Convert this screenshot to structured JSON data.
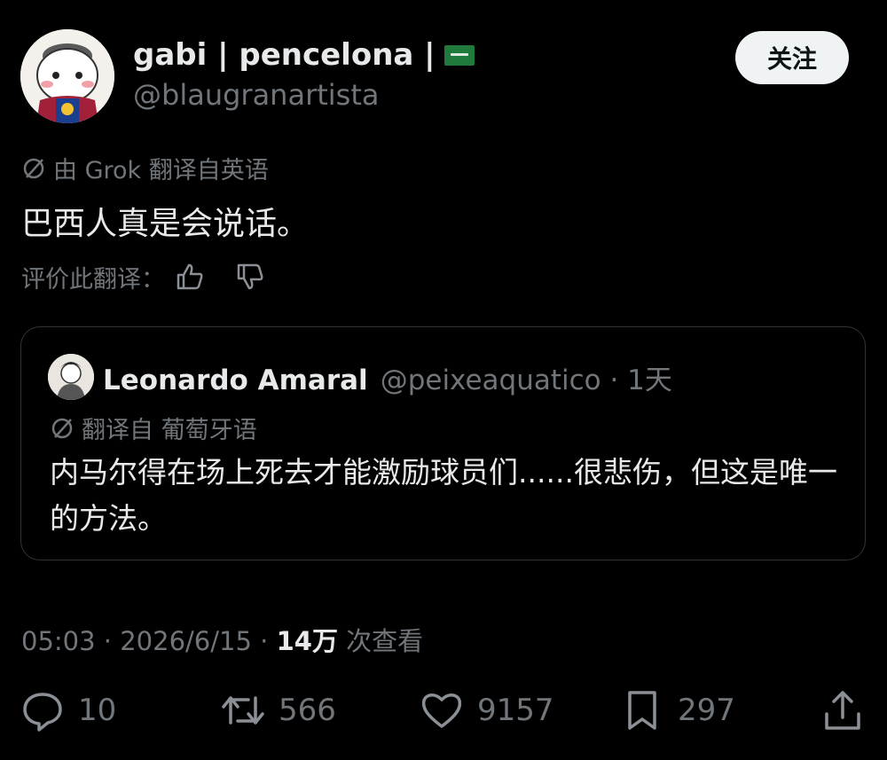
{
  "author": {
    "display_name": "gabi | pencelona |",
    "handle": "@blaugranartista",
    "avatar_icon": "cartoon-avatar"
  },
  "follow_label": "关注",
  "translation": {
    "note": "由 Grok 翻译自英语",
    "text": "巴西人真是会说话。",
    "rate_label": "评价此翻译："
  },
  "quote": {
    "name": "Leonardo Amaral",
    "meta": "@peixeaquatico · 1天",
    "translation_note": "翻译自 葡萄牙语",
    "text": "内马尔得在场上死去才能激励球员们......很悲伤，但这是唯一的方法。"
  },
  "timestamp": {
    "time": "05:03 · 2026/6/15 · ",
    "views": "14万",
    "views_suffix": " 次查看"
  },
  "actions": {
    "replies": "10",
    "retweets": "566",
    "likes": "9157",
    "bookmarks": "297"
  },
  "colors": {
    "background": "#000000",
    "text": "#e7e9ea",
    "muted": "#71767b",
    "border": "#2f3336",
    "flag_green": "#1f7a3c"
  }
}
